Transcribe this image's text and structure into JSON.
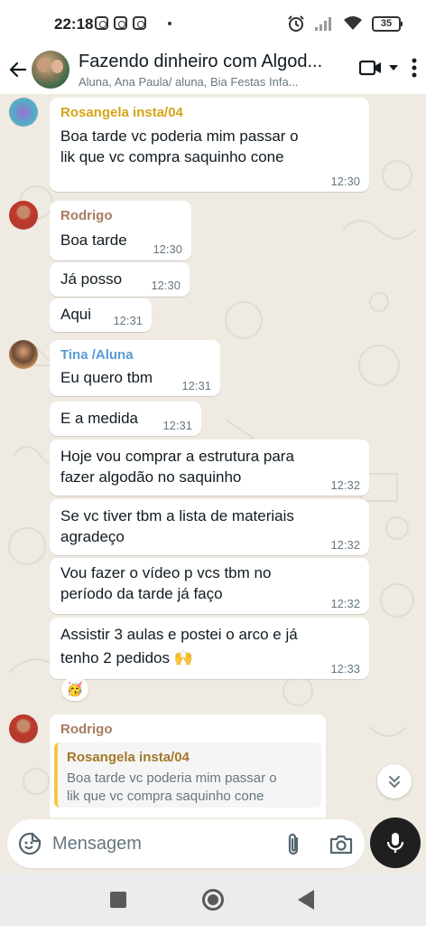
{
  "status_bar": {
    "time": "22:18",
    "battery": "35",
    "icons": [
      "instagram-icon",
      "instagram-icon",
      "instagram-icon",
      "alarm-icon",
      "signal-icon",
      "wifi-icon",
      "battery-icon"
    ]
  },
  "header": {
    "title": "Fazendo dinheiro com Algod...",
    "subtitle": "Aluna, Ana Paula/ aluna, Bia Festas Infa..."
  },
  "messages": [
    {
      "id": 1,
      "sender": "Rosangela insta/04",
      "sender_color": "#d4a417",
      "text_lines": [
        "Boa tarde vc poderia  mim passar  o",
        "lik  que vc compra  saquinho  cone"
      ],
      "time": "12:30"
    },
    {
      "id": 2,
      "sender": "Rodrigo",
      "sender_color": "#a97b63",
      "text": "Boa tarde",
      "time": "12:30"
    },
    {
      "id": 3,
      "text": "Já posso",
      "time": "12:30"
    },
    {
      "id": 4,
      "text": "Aqui",
      "time": "12:31"
    },
    {
      "id": 5,
      "sender": "Tina /Aluna",
      "sender_color": "#5a9bd5",
      "text": "Eu quero tbm",
      "time": "12:31"
    },
    {
      "id": 6,
      "text": "E a medida",
      "time": "12:31"
    },
    {
      "id": 7,
      "text_lines": [
        "Hoje vou comprar a estrutura para",
        "fazer algodão no  saquinho"
      ],
      "time": "12:32"
    },
    {
      "id": 8,
      "text_lines": [
        "Se vc tiver tbm a lista de materiais",
        "agradeço"
      ],
      "time": "12:32"
    },
    {
      "id": 9,
      "text_lines": [
        "Vou fazer o vídeo p vcs tbm no",
        "período da tarde já faço"
      ],
      "time": "12:32"
    },
    {
      "id": 10,
      "text_lines": [
        "Assistir 3 aulas e postei o arco e já",
        "tenho 2 pedidos 🙌"
      ],
      "time": "12:33",
      "reaction": "🥳"
    },
    {
      "id": 11,
      "sender": "Rodrigo",
      "sender_color": "#a97b63",
      "quoted": {
        "sender": "Rosangela insta/04",
        "text_lines": [
          "Boa tarde vc poderia  mim passar  o",
          "lik  que vc compra  saquinho  cone"
        ]
      }
    }
  ],
  "input": {
    "placeholder": "Mensagem"
  },
  "colors": {
    "chat_bg": "#efeae2",
    "bubble": "#ffffff",
    "mic_button": "#1f1f1f",
    "quote_bar": "#f7c744"
  }
}
